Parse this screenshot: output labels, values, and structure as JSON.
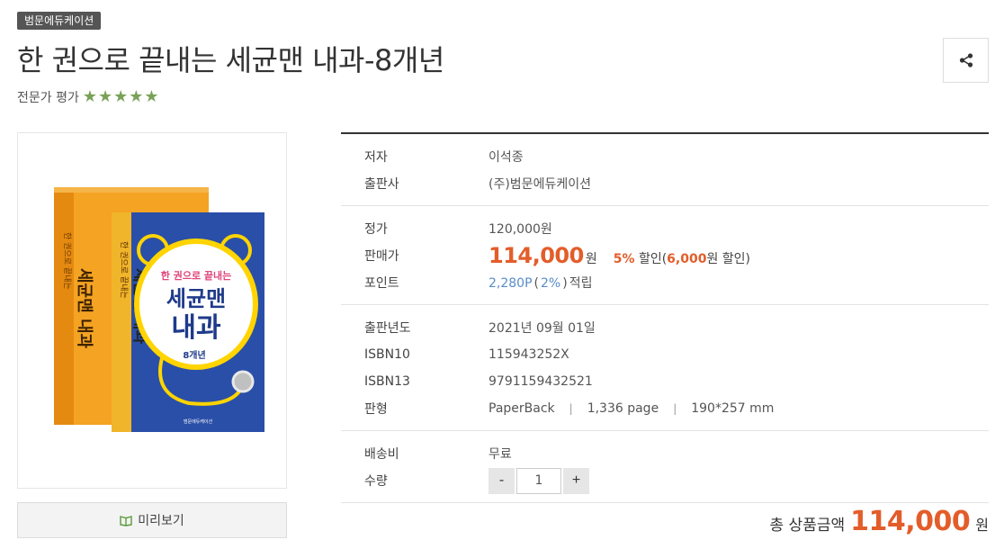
{
  "product": {
    "publisher_badge": "범문에듀케이션",
    "title": "한 권으로 끝내는 세균맨 내과-8개년",
    "rating_label": "전문가 평가",
    "rating_stars": 5
  },
  "cover": {
    "series_text": "한 권으로 끝내는",
    "title_line1": "세균맨",
    "title_line2": "내과",
    "edition": "8개년",
    "side_title": "세균맨 내과",
    "publisher": "범문에듀케이션",
    "colors": {
      "front": "#2a4fa8",
      "back": "#f4a323",
      "accent": "#ffd400"
    }
  },
  "preview": {
    "label": "미리보기"
  },
  "info": {
    "author": {
      "label": "저자",
      "value": "이석종"
    },
    "publisher": {
      "label": "출판사",
      "value": "(주)범문에듀케이션"
    },
    "list_price": {
      "label": "정가",
      "value": "120,000원"
    },
    "sale_price": {
      "label": "판매가",
      "amount": "114,000",
      "unit": "원",
      "discount_rate": "5%",
      "discount_text_a": "할인(",
      "discount_amount": "6,000",
      "discount_text_b": "원 할인)"
    },
    "points": {
      "label": "포인트",
      "amount": "2,280P",
      "open": "(",
      "rate": "2%",
      "close": ")",
      "suffix": "적립"
    },
    "pub_date": {
      "label": "출판년도",
      "value": "2021년 09월 01일"
    },
    "isbn10": {
      "label": "ISBN10",
      "value": "115943252X"
    },
    "isbn13": {
      "label": "ISBN13",
      "value": "9791159432521"
    },
    "format": {
      "label": "판형",
      "binding": "PaperBack",
      "pages": "1,336 page",
      "size": "190*257 mm",
      "separator": "|"
    },
    "shipping": {
      "label": "배송비",
      "value": "무료"
    },
    "quantity": {
      "label": "수량",
      "value": "1",
      "minus": "-",
      "plus": "+"
    }
  },
  "total": {
    "label": "총 상품금액",
    "amount": "114,000",
    "unit": "원"
  },
  "colors": {
    "accent": "#e35d2a",
    "star": "#7aa257",
    "link_blue": "#5a8cc9"
  }
}
